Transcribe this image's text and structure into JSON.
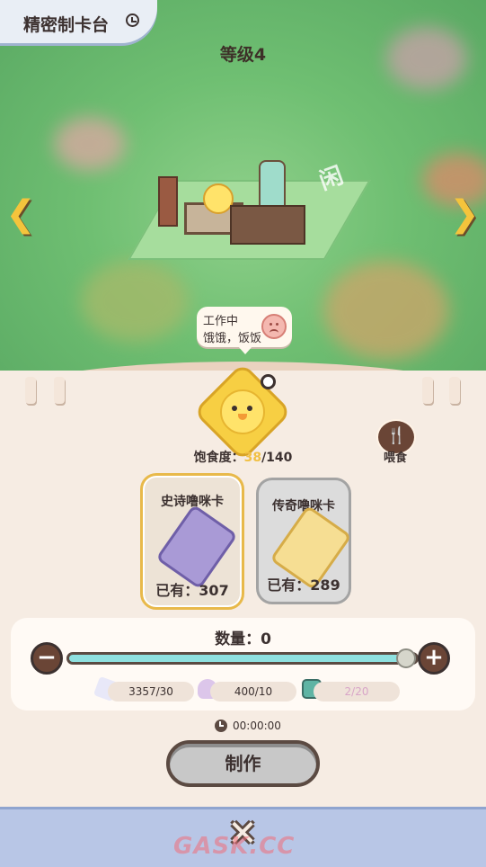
{
  "header": {
    "title": "精密制卡台",
    "level": "等级4"
  },
  "bubble": {
    "line1": "工作中",
    "line2": "饿饿，饭饭"
  },
  "pet": {
    "satiety_label": "饱食度：",
    "satiety_current": "38",
    "satiety_max": "/140",
    "feed_label": "喂食"
  },
  "cards": [
    {
      "name": "史诗噜咪卡",
      "owned": "已有：307",
      "selected": true
    },
    {
      "name": "传奇噜咪卡",
      "owned": "已有：289",
      "selected": false
    }
  ],
  "quantity": {
    "label": "数量：0",
    "value": 0,
    "minus": "−",
    "plus": "+"
  },
  "resources": [
    {
      "icon": "star-shard-icon",
      "text": "3357/30"
    },
    {
      "icon": "purple-dust-icon",
      "text": "400/10"
    },
    {
      "icon": "teal-cube-icon",
      "text": "2/20"
    }
  ],
  "timer": {
    "text": "00:00:00"
  },
  "actions": {
    "make_label": "制作",
    "close_symbol": "✕"
  },
  "nav": {
    "left": "❮",
    "right": "❯"
  },
  "watermark": "GASK.CC"
}
